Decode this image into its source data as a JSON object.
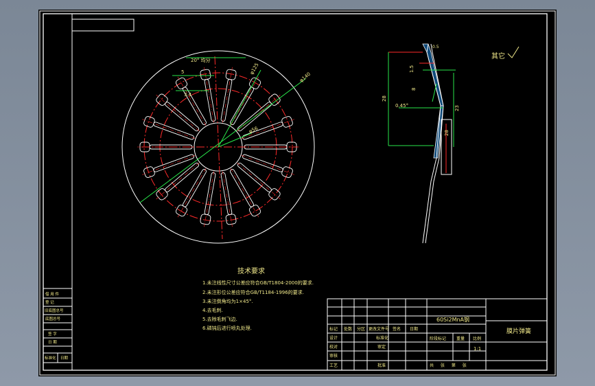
{
  "colors": {
    "background": "#7f8b9a",
    "sheet": "#000000",
    "lines": "#ffffff",
    "center_lines": "#ff2a2a",
    "dimensions": "#29e64a",
    "text": "#f0e88a"
  },
  "dimensions": {
    "pitch_angle": "20° 均分",
    "d1": "φ140",
    "d2": "φ125",
    "d3": "φ56",
    "w1": "5",
    "w2": "3.4",
    "side_a": "1.5",
    "side_b": "8",
    "side_c": "0.45°",
    "side_d": "28",
    "side_e": "23",
    "side_f": "28",
    "side_g": "0.5"
  },
  "surface_note": "其它",
  "tech_requirements": {
    "title": "技术要求",
    "items": [
      "1.未注线性尺寸公差应符合GB/T1804-2000的要求.",
      "2.未注形位公差应符合GB/T1184-1996的要求.",
      "3.未注倒角均为1×45°.",
      "4.去毛刺.",
      "5.去除毛刺飞边.",
      "6.磷钝后进行喷丸处理."
    ]
  },
  "left_strip": {
    "labels": [
      "借 用 件",
      "登 记",
      "旧底图总号",
      "底图总号",
      "签 字",
      "日 期",
      "标准化",
      "日期"
    ]
  },
  "title_block": {
    "material": "60Si2MnA钢",
    "part_name": "膜片弹簧",
    "header_labels": [
      "标记",
      "处数",
      "分区",
      "更改文件号",
      "签名",
      "日期"
    ],
    "rows": [
      [
        "设计",
        "",
        "标准化",
        ""
      ],
      [
        "校对",
        "",
        "",
        ""
      ],
      [
        "审核",
        "",
        "审定",
        ""
      ],
      [
        "工艺",
        "",
        "批准",
        ""
      ]
    ],
    "stage_label": "阶段标记",
    "weight_label": "重量",
    "scale_label": "比例",
    "scale_value": "1:1",
    "sheet_label": "共 张 第 张"
  }
}
